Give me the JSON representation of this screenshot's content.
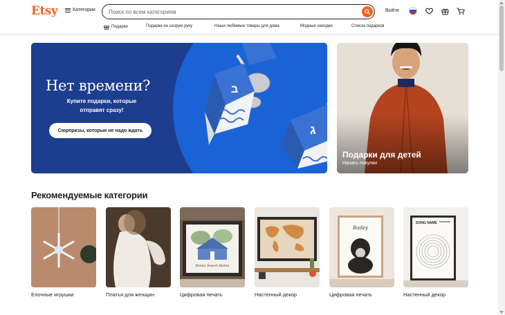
{
  "header": {
    "logo": "Etsy",
    "categories_label": "Категории",
    "search_placeholder": "Поиск по всем категориям",
    "signin_label": "Войти"
  },
  "nav": {
    "items": [
      {
        "label": "Подарки",
        "icon": "gift-icon"
      },
      {
        "label": "Подарки на скорую руку"
      },
      {
        "label": "Наши любимые товары для дома"
      },
      {
        "label": "Модные находки"
      },
      {
        "label": "Список подарков"
      }
    ]
  },
  "hero": {
    "title": "Нет времени?",
    "subtitle": "Купите подарки, которые отправят сразу!",
    "button": "Сюрпризы, которые не надо ждать"
  },
  "promo": {
    "title": "Подарки для детей",
    "link": "Начать покупки"
  },
  "recommended": {
    "title": "Рекомендуемые категории",
    "items": [
      {
        "label": "Елочные игрушки"
      },
      {
        "label": "Платья для женщин"
      },
      {
        "label": "Цифровая печать"
      },
      {
        "label": "Настенный декор"
      },
      {
        "label": "Цифровая печать"
      },
      {
        "label": "Настенный декор"
      }
    ]
  },
  "colors": {
    "brand": "#f1641e",
    "hero_bg": "#1d3d8f",
    "hero_accent": "#1a63d6"
  }
}
